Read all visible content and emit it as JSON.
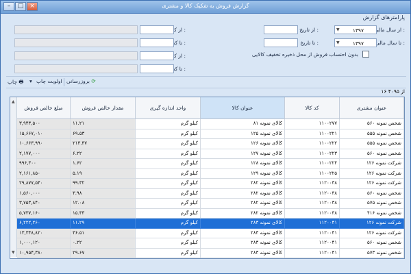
{
  "window": {
    "title": "گزارش فروش به تفکیک کالا و مشتری",
    "buttons": {
      "minimize": "–",
      "maximize": "□",
      "close": "×"
    }
  },
  "params": {
    "section_label": "پارامترهای گزارش",
    "from_year_label": "از سال مالی :",
    "from_year_value": "۱۳۹۷",
    "to_year_label": "تا سال مالی :",
    "to_year_value": "۱۳۹۷",
    "from_date_label": "از تاریخ :",
    "to_date_label": "تا تاریخ :",
    "from_customer_label": "از کد مشتری :",
    "to_customer_label": "تا کد مشتری :",
    "from_product_label": "از کد کالا :",
    "to_product_label": "تا کد کالا :",
    "checkbox_label": "بدون احتساب فروش از محل ذخیره تخفیف کالایی"
  },
  "toolbar": {
    "refresh_label": "بروزرسانی",
    "priority_label": "اولویت چاپ",
    "print_label": "چاپ"
  },
  "record_count": "از ۴۰۹۵ ۱۶",
  "table": {
    "columns": [
      "عنوان مشتری",
      "کد کالا",
      "عنوان کالا",
      "واحد اندازه گیری",
      "مقدار خالص فروش",
      "مبلغ خالص فروش"
    ],
    "selected_row": 12,
    "rows": [
      [
        "شخص نمونه ۵۶۰",
        "۱۱۰۰۲۷۷",
        "کالای نمونه ۸۱",
        "کیلو گرم",
        "۱۱.۲۱",
        "۳,۹۴۳,۵۰۰"
      ],
      [
        "شخص نمونه ۵۵۵",
        "۱۱۰۰۲۲۱",
        "کالای نمونه ۱۲۵",
        "کیلو گرم",
        "۶۹.۵۳",
        "۱۵,۶۶۷,۰۱۰"
      ],
      [
        "شخص نمونه ۵۵۵",
        "۱۱۰۰۲۲۲",
        "کالای نمونه ۱۲۶",
        "کیلو گرم",
        "۲۱۳.۴۷",
        "۱۰,۶۶۳,۹۹۰"
      ],
      [
        "شخص نمونه ۵۶۰",
        "۱۱۰۰۲۲۳",
        "کالای نمونه ۱۲۷",
        "کیلو گرم",
        "۶.۲۲",
        "۲,۱۷۷,۰۰۰"
      ],
      [
        "شرکت نمونه ۱۲۶",
        "۱۱۰۰۲۲۴",
        "کالای نمونه ۱۲۸",
        "کیلو گرم",
        "۱.۶۲",
        "۹۹۶,۳۰۰"
      ],
      [
        "شرکت نمونه ۱۲۶",
        "۱۱۰۰۲۲۵",
        "کالای نمونه ۱۲۹",
        "کیلو گرم",
        "۵.۱۹",
        "۲,۱۶۱,۸۵۰"
      ],
      [
        "شرکت نمونه ۱۲۶",
        "۱۱۲۰۰۳۸",
        "کالای نمونه ۲۸۲",
        "کیلو گرم",
        "۹۹.۳۲",
        "۲۹,۸۷۷,۵۴۰"
      ],
      [
        "شخص نمونه ۵۶۰",
        "۱۱۲۰۰۳۸",
        "کالای نمونه ۲۸۲",
        "کیلو گرم",
        "۳.۹۸",
        "۱,۵۶۰,۰۰۰"
      ],
      [
        "شخص نمونه ۵۷۵",
        "۱۱۲۰۰۳۸",
        "کالای نمونه ۲۸۲",
        "کیلو گرم",
        "۱۲.۰۸",
        "۳,۷۵۳,۸۴۰"
      ],
      [
        "شخص نمونه ۴۱۶",
        "۱۱۲۰۰۳۸",
        "کالای نمونه ۲۸۲",
        "کیلو گرم",
        "۱۵.۴۳",
        "۵,۷۳۷,۱۶۰"
      ],
      [
        "شرکت نمونه ۱۲۶",
        "۱۱۲۰۰۴۱",
        "کالای نمونه ۲۸۳",
        "کیلو گرم",
        "۱۱.۲۹",
        "۶,۲۲۲,۲۶۰"
      ],
      [
        "شرکت نمونه ۱۲۶",
        "۱۱۲۰۰۴۱",
        "کالای نمونه ۲۸۳",
        "کیلو گرم",
        "۳۶.۵۱",
        "۱۳,۳۴۸,۸۲۰"
      ],
      [
        "شخص نمونه ۵۶۰",
        "۱۱۲۰۰۴۱",
        "کالای نمونه ۲۸۳",
        "کیلو گرم",
        "۰.۲۲",
        "۱,۰۰۰,۱۲۰"
      ],
      [
        "شخص نمونه ۵۷۳",
        "۱۱۲۰۰۴۱",
        "کالای نمونه ۲۸۳",
        "کیلو گرم",
        "۲۹.۶۷",
        "۱۰,۹۵۴,۳۸۰"
      ],
      [
        "شرکت نمونه ۱۲۶",
        "۱۱۲۰۱۱۶",
        "کالای نمونه ۲۹۸",
        "کیلو گرم",
        "۵۴.۰۹",
        "۱۹,۶۸۹,۰۹۰"
      ],
      [
        "شرکت نمونه ۱۲۶",
        "۱۱۲۰۱۱۹",
        "کالای نمونه ۳۰۱",
        "کیلو گرم",
        "۱۷.۶۳",
        "۷,۰۷۳,۶۴۰"
      ]
    ]
  }
}
